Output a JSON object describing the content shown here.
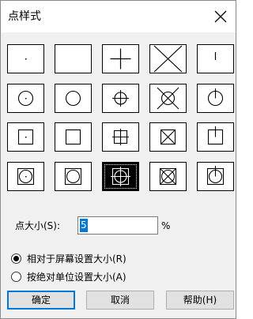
{
  "title": "点样式",
  "close_icon": "close-icon",
  "styles": [
    {
      "row": 1,
      "col": 1,
      "icon": "point-dot"
    },
    {
      "row": 1,
      "col": 2,
      "icon": "point-none"
    },
    {
      "row": 1,
      "col": 3,
      "icon": "point-plus"
    },
    {
      "row": 1,
      "col": 4,
      "icon": "point-x"
    },
    {
      "row": 1,
      "col": 5,
      "icon": "point-tick"
    },
    {
      "row": 2,
      "col": 1,
      "icon": "point-circle-dot"
    },
    {
      "row": 2,
      "col": 2,
      "icon": "point-circle"
    },
    {
      "row": 2,
      "col": 3,
      "icon": "point-circle-plus"
    },
    {
      "row": 2,
      "col": 4,
      "icon": "point-circle-x"
    },
    {
      "row": 2,
      "col": 5,
      "icon": "point-circle-tick"
    },
    {
      "row": 3,
      "col": 1,
      "icon": "point-square-dot"
    },
    {
      "row": 3,
      "col": 2,
      "icon": "point-square"
    },
    {
      "row": 3,
      "col": 3,
      "icon": "point-square-plus"
    },
    {
      "row": 3,
      "col": 4,
      "icon": "point-square-x"
    },
    {
      "row": 3,
      "col": 5,
      "icon": "point-square-tick"
    },
    {
      "row": 4,
      "col": 1,
      "icon": "point-circle-square-dot"
    },
    {
      "row": 4,
      "col": 2,
      "icon": "point-circle-square"
    },
    {
      "row": 4,
      "col": 3,
      "icon": "point-circle-square-plus",
      "selected": true
    },
    {
      "row": 4,
      "col": 4,
      "icon": "point-circle-square-x"
    },
    {
      "row": 4,
      "col": 5,
      "icon": "point-circle-square-tick"
    }
  ],
  "size": {
    "label": "点大小(S):",
    "value": "5",
    "unit": "%"
  },
  "radios": [
    {
      "label": "相对于屏幕设置大小(R)",
      "checked": true
    },
    {
      "label": "按绝对单位设置大小(A)",
      "checked": false
    }
  ],
  "buttons": {
    "ok": "确定",
    "cancel": "取消",
    "help": "帮助(H)"
  },
  "colors": {
    "selection": "#0078d7",
    "selected_cell": "#000000"
  }
}
